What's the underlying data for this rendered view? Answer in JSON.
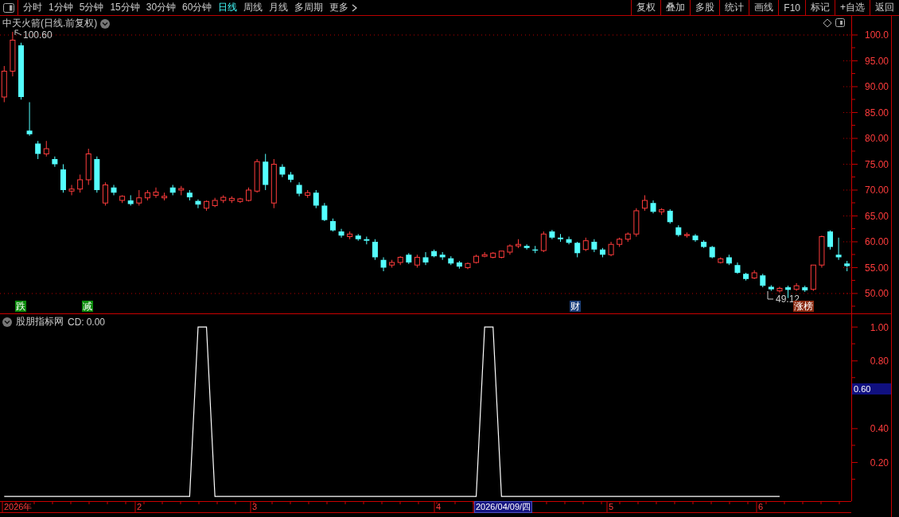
{
  "toolbar": {
    "periods": [
      {
        "label": "分时",
        "selected": false
      },
      {
        "label": "1分钟",
        "selected": false
      },
      {
        "label": "5分钟",
        "selected": false
      },
      {
        "label": "15分钟",
        "selected": false
      },
      {
        "label": "30分钟",
        "selected": false
      },
      {
        "label": "60分钟",
        "selected": false
      },
      {
        "label": "日线",
        "selected": true
      },
      {
        "label": "周线",
        "selected": false
      },
      {
        "label": "月线",
        "selected": false
      },
      {
        "label": "多周期",
        "selected": false
      },
      {
        "label": "更多",
        "selected": false
      }
    ],
    "actions": [
      "复权",
      "叠加",
      "多股",
      "统计",
      "画线",
      "F10",
      "标记",
      "+自选",
      "返回"
    ]
  },
  "price_chart": {
    "title": "中天火箭(日线.前复权)",
    "high_label": "100.60",
    "low_label": "49.12",
    "markers": [
      {
        "text": "跌",
        "color": "#0a8a0a"
      },
      {
        "text": "减",
        "color": "#0a8a0a"
      },
      {
        "text": "财",
        "color": "#1a3f7a"
      },
      {
        "text": "涨榜",
        "color": "#8a2a10"
      }
    ],
    "chart_data": {
      "type": "candlestick",
      "ylim": [
        46.15,
        103.69
      ],
      "yticks": [
        {
          "value": 100,
          "label": "100.0"
        },
        {
          "value": 95,
          "label": "95.00"
        },
        {
          "value": 90,
          "label": "90.00"
        },
        {
          "value": 85,
          "label": "85.00"
        },
        {
          "value": 80,
          "label": "80.00"
        },
        {
          "value": 75,
          "label": "75.00"
        },
        {
          "value": 70,
          "label": "70.00"
        },
        {
          "value": 65,
          "label": "65.00"
        },
        {
          "value": 60,
          "label": "60.00"
        },
        {
          "value": 55,
          "label": "55.00"
        },
        {
          "value": 50,
          "label": "50.00"
        }
      ],
      "categories": [
        null,
        null,
        null,
        null,
        null,
        null,
        null,
        null,
        null,
        null,
        null,
        null,
        null,
        null,
        null,
        null,
        null,
        null,
        null,
        null,
        null,
        null,
        null,
        null,
        null,
        null,
        null,
        null,
        null,
        null,
        null,
        null,
        null,
        null,
        null,
        null,
        null,
        null,
        null,
        null,
        null,
        null,
        null,
        null,
        null,
        null,
        null,
        null,
        null,
        null,
        null,
        null,
        null,
        null,
        null,
        null,
        null,
        null,
        null,
        null,
        null,
        null,
        null,
        null,
        null,
        null,
        null,
        null,
        null,
        null,
        null,
        null,
        null,
        null,
        null,
        null,
        null,
        null,
        null,
        null,
        null,
        null,
        null,
        null,
        null,
        null,
        null,
        null,
        null,
        null,
        null,
        null,
        null,
        null,
        null,
        null,
        null,
        null,
        null,
        null,
        null
      ],
      "ohlc": [
        [
          88,
          94,
          87,
          93
        ],
        [
          93,
          100.6,
          92,
          99
        ],
        [
          98,
          98.5,
          87.5,
          88
        ],
        [
          81.5,
          87,
          80.5,
          80.8
        ],
        [
          79,
          79.5,
          76,
          77
        ],
        [
          77,
          79.5,
          76.5,
          78
        ],
        [
          76,
          76.5,
          74.5,
          75
        ],
        [
          74,
          75,
          69.5,
          70
        ],
        [
          69.8,
          71,
          69,
          70.2
        ],
        [
          70.2,
          73,
          69.5,
          72
        ],
        [
          72,
          78,
          71,
          77
        ],
        [
          76,
          76.5,
          69.5,
          70
        ],
        [
          67.5,
          71.5,
          67,
          71
        ],
        [
          70.5,
          71,
          69,
          69.5
        ],
        [
          68,
          69,
          67.5,
          68.8
        ],
        [
          68,
          69,
          67,
          67.3
        ],
        [
          67.5,
          70,
          67,
          68.5
        ],
        [
          68.5,
          70,
          68,
          69.5
        ],
        [
          69,
          70.5,
          68.5,
          69.6
        ],
        [
          68.5,
          69.5,
          68,
          68.8
        ],
        [
          70.5,
          71,
          69,
          69.5
        ],
        [
          70,
          70.8,
          69,
          70.3
        ],
        [
          69.5,
          70,
          68,
          68.6
        ],
        [
          67.9,
          68.2,
          66.5,
          67.2
        ],
        [
          66.5,
          68,
          66,
          67.8
        ],
        [
          67,
          68.5,
          66.7,
          68
        ],
        [
          68,
          69,
          67.5,
          68.6
        ],
        [
          68,
          68.8,
          67.5,
          68.4
        ],
        [
          67.8,
          68.5,
          67.5,
          68.3
        ],
        [
          68,
          70.5,
          67.8,
          70
        ],
        [
          69.8,
          76,
          69.5,
          75.5
        ],
        [
          75.5,
          77,
          70,
          71
        ],
        [
          67.5,
          76,
          66.5,
          75
        ],
        [
          74.5,
          75,
          72.5,
          73
        ],
        [
          73,
          73.5,
          71.5,
          72
        ],
        [
          71,
          71.5,
          68.8,
          69.3
        ],
        [
          69,
          70,
          68.5,
          69.5
        ],
        [
          69.5,
          70,
          66.5,
          67
        ],
        [
          67,
          67.5,
          64,
          64.2
        ],
        [
          64,
          64.5,
          62,
          62.2
        ],
        [
          62,
          62.5,
          60.8,
          61.2
        ],
        [
          61,
          62,
          60.5,
          61.5
        ],
        [
          61.2,
          61.5,
          60.2,
          60.5
        ],
        [
          60.5,
          61,
          59.5,
          60.2
        ],
        [
          60,
          60.5,
          56.5,
          57
        ],
        [
          56.5,
          57,
          54.3,
          55
        ],
        [
          55.5,
          56.5,
          55,
          56
        ],
        [
          56,
          57.2,
          55.5,
          57
        ],
        [
          57.5,
          57.8,
          55.7,
          56
        ],
        [
          55.5,
          57.5,
          55,
          57
        ],
        [
          57,
          58,
          55.5,
          56
        ],
        [
          58.2,
          58.5,
          57,
          57.2
        ],
        [
          57.5,
          58,
          56.5,
          57
        ],
        [
          56.8,
          57.2,
          55.5,
          55.8
        ],
        [
          56,
          56.3,
          54.8,
          55.2
        ],
        [
          55,
          56,
          54.7,
          55.8
        ],
        [
          56,
          57.5,
          55.8,
          57.2
        ],
        [
          57.2,
          58,
          57,
          57.5
        ],
        [
          57,
          58,
          56.8,
          57.8
        ],
        [
          57,
          58.3,
          56.8,
          58.2
        ],
        [
          58,
          59.5,
          57.5,
          59.2
        ],
        [
          59.2,
          60.5,
          58.8,
          59.5
        ],
        [
          59.2,
          59.5,
          58.5,
          58.8
        ],
        [
          58.5,
          59.2,
          57.8,
          58.3
        ],
        [
          58.3,
          62,
          58,
          61.5
        ],
        [
          62,
          62.3,
          60.5,
          60.8
        ],
        [
          60.8,
          61.5,
          60,
          60.5
        ],
        [
          60.5,
          61,
          59.5,
          59.8
        ],
        [
          59.8,
          60,
          57,
          57.8
        ],
        [
          58.5,
          60.8,
          58.2,
          60.2
        ],
        [
          60,
          60.5,
          58,
          58.5
        ],
        [
          58.5,
          58.8,
          57,
          57.5
        ],
        [
          57.5,
          60,
          57.2,
          59.5
        ],
        [
          59.5,
          60.8,
          59,
          60.5
        ],
        [
          60.5,
          61.8,
          60,
          61.5
        ],
        [
          61.5,
          66.5,
          61,
          66
        ],
        [
          66.5,
          69,
          66,
          68
        ],
        [
          67.5,
          68,
          65.5,
          65.8
        ],
        [
          65.8,
          66.5,
          65.2,
          66.2
        ],
        [
          66,
          66.3,
          63.5,
          63.8
        ],
        [
          62.8,
          63.2,
          61,
          61.3
        ],
        [
          61.2,
          61.8,
          60.8,
          61.4
        ],
        [
          61.2,
          61.5,
          60,
          60.3
        ],
        [
          60,
          60.3,
          58.8,
          59
        ],
        [
          59,
          59.2,
          56.8,
          57
        ],
        [
          56,
          57,
          55.8,
          56.7
        ],
        [
          57,
          57.5,
          55.5,
          55.8
        ],
        [
          55.5,
          56,
          53.8,
          54
        ],
        [
          53.8,
          54,
          52.5,
          52.8
        ],
        [
          53,
          54.5,
          52.8,
          54
        ],
        [
          53.5,
          53.8,
          51.2,
          51.5
        ],
        [
          51.3,
          51.6,
          50.5,
          50.8
        ],
        [
          50.5,
          51.3,
          50.2,
          51
        ],
        [
          51.2,
          51.5,
          49.12,
          50.7
        ],
        [
          50.8,
          52,
          50.5,
          51.5
        ],
        [
          51.2,
          51.5,
          50.3,
          50.6
        ],
        [
          50.8,
          55.5,
          50.5,
          55.5
        ],
        [
          55.5,
          61.2,
          55,
          61
        ],
        [
          62,
          62.2,
          58.5,
          59
        ],
        [
          57.5,
          60.8,
          56.5,
          57
        ],
        [
          55.8,
          56.3,
          54.3,
          55.3
        ]
      ]
    }
  },
  "indicator": {
    "name": "股朋指标网",
    "reading": "0.00",
    "cursor_value": "0.60",
    "chart_data": {
      "type": "line",
      "ylim": [
        -0.028,
        1.076
      ],
      "yticks": [
        {
          "value": 0.2,
          "label": "0.20"
        },
        {
          "value": 0.4,
          "label": "0.40"
        },
        {
          "value": 0.8,
          "label": "0.80"
        },
        {
          "value": 1.0,
          "label": "1.00"
        }
      ],
      "categories": [
        null,
        null,
        null,
        null,
        null,
        null,
        null,
        null,
        null,
        null,
        null,
        null,
        null,
        null,
        null,
        null,
        null,
        null,
        null,
        null,
        null,
        null,
        null,
        null,
        null,
        null,
        null,
        null,
        null,
        null,
        null,
        null,
        null,
        null,
        null,
        null,
        null,
        null,
        null,
        null,
        null,
        null,
        null,
        null,
        null,
        null,
        null,
        null,
        null,
        null,
        null,
        null,
        null,
        null,
        null,
        null,
        null,
        null,
        null,
        null,
        null,
        null,
        null,
        null,
        null,
        null,
        null,
        null,
        null,
        null,
        null,
        null,
        null,
        null,
        null,
        null,
        null,
        null,
        null,
        null,
        null,
        null,
        null,
        null,
        null,
        null,
        null,
        null,
        null,
        null,
        null,
        null,
        null,
        null,
        null,
        null,
        null,
        null,
        null,
        null,
        null
      ],
      "series": [
        {
          "name": "CD:",
          "color": "#ffffff",
          "values": [
            0,
            0,
            0,
            0,
            0,
            0,
            0,
            0,
            0,
            0,
            0,
            0,
            0,
            0,
            0,
            0,
            0,
            0,
            0,
            0,
            0,
            0,
            0,
            1,
            1,
            0,
            0,
            0,
            0,
            0,
            0,
            0,
            0,
            0,
            0,
            0,
            0,
            0,
            0,
            0,
            0,
            0,
            0,
            0,
            0,
            0,
            0,
            0,
            0,
            0,
            0,
            0,
            0,
            0,
            0,
            0,
            0,
            1,
            1,
            0,
            0,
            0,
            0,
            0,
            0,
            0,
            0,
            0,
            0,
            0,
            0,
            0,
            0,
            0,
            0,
            0,
            0,
            0,
            0,
            0,
            0,
            0,
            0,
            0,
            0,
            0,
            0,
            0,
            0,
            0,
            0,
            0,
            0,
            null,
            null,
            null,
            null,
            null,
            null,
            null,
            null
          ]
        }
      ]
    }
  },
  "date_axis": [
    {
      "text": "2026年",
      "kind": "tick"
    },
    {
      "text": "2",
      "kind": "tick"
    },
    {
      "text": "3",
      "kind": "tick"
    },
    {
      "text": "4",
      "kind": "tick"
    },
    {
      "text": "2026/04/09/四",
      "kind": "cursor"
    },
    {
      "text": "5",
      "kind": "tick"
    },
    {
      "text": "6",
      "kind": "tick"
    }
  ]
}
